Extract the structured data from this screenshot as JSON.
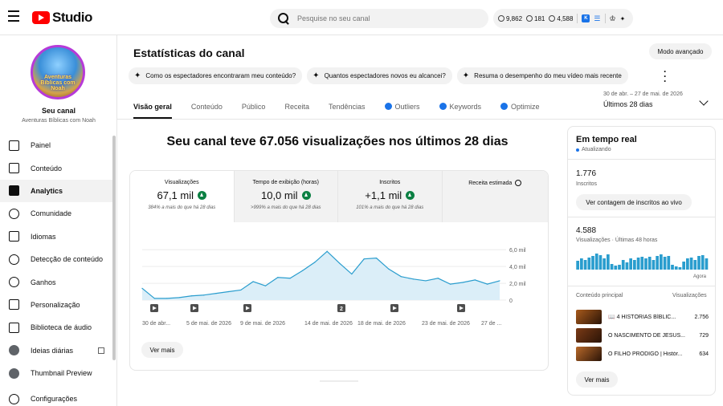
{
  "header": {
    "app_name": "Studio",
    "search_placeholder": "Pesquise no seu canal",
    "stats": {
      "subs": "9,862",
      "views": "181",
      "watch": "4,588"
    },
    "badge_label": "K"
  },
  "sidebar": {
    "avatar_text": "Aventuras Bíblicas com Noah",
    "channel_name": "Seu canal",
    "channel_handle": "Aventuras Bíblicas com Noah",
    "items": [
      {
        "label": "Painel",
        "icon": "dashboard-icon"
      },
      {
        "label": "Conteúdo",
        "icon": "content-icon"
      },
      {
        "label": "Analytics",
        "icon": "analytics-icon",
        "active": true
      },
      {
        "label": "Comunidade",
        "icon": "community-icon"
      },
      {
        "label": "Idiomas",
        "icon": "subtitles-icon"
      },
      {
        "label": "Detecção de conteúdo",
        "icon": "copyright-icon"
      },
      {
        "label": "Ganhos",
        "icon": "dollar-icon"
      },
      {
        "label": "Personalização",
        "icon": "magic-wand-icon"
      },
      {
        "label": "Biblioteca de áudio",
        "icon": "audio-library-icon"
      },
      {
        "label": "Ideias diárias",
        "icon": "ideas-icon",
        "external": true
      },
      {
        "label": "Thumbnail Preview",
        "icon": "thumbnail-preview-icon"
      },
      {
        "label": "Configurações",
        "icon": "gear-icon"
      }
    ]
  },
  "main": {
    "title": "Estatísticas do canal",
    "advanced_mode": "Modo avançado",
    "chips": [
      "Como os espectadores encontraram meu conteúdo?",
      "Quantos espectadores novos eu alcancei?",
      "Resuma o desempenho do meu vídeo mais recente"
    ],
    "tabs": [
      {
        "label": "Visão geral",
        "active": true
      },
      {
        "label": "Conteúdo"
      },
      {
        "label": "Público"
      },
      {
        "label": "Receita"
      },
      {
        "label": "Tendências"
      },
      {
        "label": "Outliers",
        "icon": true
      },
      {
        "label": "Keywords",
        "icon": true
      },
      {
        "label": "Optimize",
        "icon": true
      }
    ],
    "date_range_small": "30 de abr. – 27 de mai. de 2026",
    "date_range_main": "Últimos 28 dias",
    "headline": "Seu canal teve 67.056 visualizações nos últimos 28 dias",
    "metrics": [
      {
        "label": "Visualizações",
        "value": "67,1 mil",
        "sub": "384% a mais do que há 28 dias"
      },
      {
        "label": "Tempo de exibição (horas)",
        "value": "10,0 mil",
        "sub": ">999% a mais do que há 28 dias"
      },
      {
        "label": "Inscritos",
        "value": "+1,1 mil",
        "sub": "101% a mais do que há 28 dias"
      },
      {
        "label": "Receita estimada"
      }
    ],
    "see_more": "Ver mais"
  },
  "chart_data": {
    "type": "area",
    "x_ticks": [
      "30 de abr...",
      "5 de mai. de 2026",
      "9 de mai. de 2026",
      "14 de mai. de 2026",
      "18 de mai. de 2026",
      "23 de mai. de 2026",
      "27 de ..."
    ],
    "y_ticks": [
      "6,0 mil",
      "4,0 mil",
      "2,0 mil",
      "0"
    ],
    "ylim": [
      0,
      6400
    ],
    "values": [
      1400,
      200,
      200,
      300,
      500,
      600,
      800,
      1000,
      1200,
      2200,
      1700,
      2700,
      2600,
      3500,
      4500,
      5800,
      4400,
      3100,
      4900,
      5000,
      3700,
      2800,
      2500,
      2300,
      2600,
      1900,
      2100,
      2400,
      1900,
      2300
    ],
    "markers": [
      "play",
      "play",
      "play",
      "2",
      "play",
      "play"
    ],
    "color": "#2a9dce",
    "fill": "#dbeef8"
  },
  "realtime": {
    "title": "Em tempo real",
    "live_label": "Atualizando",
    "subs_value": "1.776",
    "subs_label": "Inscritos",
    "subs_btn": "Ver contagem de inscritos ao vivo",
    "views_value": "4.588",
    "views_label": "Visualizações · Últimas 48 horas",
    "bars": [
      0.55,
      0.7,
      0.6,
      0.75,
      0.85,
      1.0,
      0.9,
      0.7,
      0.95,
      0.35,
      0.25,
      0.3,
      0.6,
      0.45,
      0.7,
      0.6,
      0.75,
      0.8,
      0.7,
      0.8,
      0.6,
      0.85,
      0.95,
      0.8,
      0.85,
      0.3,
      0.2,
      0.15,
      0.5,
      0.7,
      0.75,
      0.6,
      0.85,
      0.9,
      0.7
    ],
    "now_label": "Agora",
    "table_header_left": "Conteúdo principal",
    "table_header_right": "Visualizações",
    "videos": [
      {
        "title": "📖 4 HISTÓRIAS BÍBLIC...",
        "views": "2.756",
        "color": "#a85a1c"
      },
      {
        "title": "O NASCIMENTO DE JESUS...",
        "views": "729",
        "color": "#7a3a16"
      },
      {
        "title": "O FILHO PRÓDIGO | Histór...",
        "views": "634",
        "color": "#b8692a"
      }
    ],
    "see_more": "Ver mais"
  }
}
